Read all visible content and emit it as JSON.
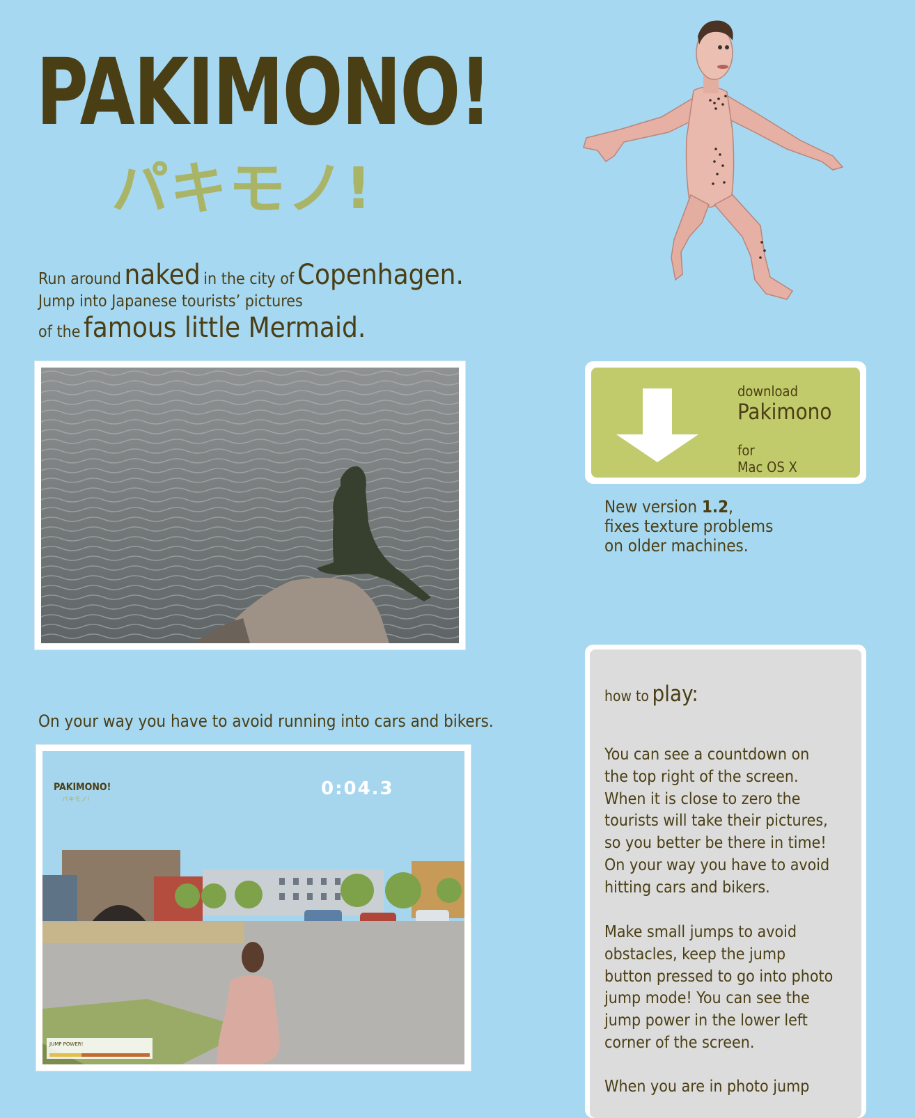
{
  "logo": {
    "title": "PAKIMONO!",
    "katakana": "パキモノ!"
  },
  "tagline": {
    "l1_a": "Run around",
    "l1_b": "naked",
    "l1_c": "in the city of",
    "l1_d": "Copenhagen.",
    "l2": "Jump into Japanese tourists’ pictures",
    "l3_a": "of the",
    "l3_b": "famous little Mermaid."
  },
  "caption2": "On your way you have to avoid running into cars and bikers.",
  "game": {
    "logo": "PAKIMONO!",
    "logo_jp": "パキモノ!",
    "timer": "0:04.3",
    "jump_label": "JUMP POWER!",
    "jump_power": 0.32
  },
  "download": {
    "label": "download",
    "title": "Pakimono",
    "for": "for",
    "platform": "Mac OS X"
  },
  "version": {
    "a": "New version",
    "num": "1.2",
    "comma": ",",
    "line2": "fixes texture problems",
    "line3": "on older machines."
  },
  "howto": {
    "title_a": "how to",
    "title_b": "play:",
    "p1": [
      "You can see a countdown on",
      "the top right of the screen.",
      "When it is close to zero the",
      "tourists will take their pictures,",
      "so you better be there in time!",
      "On your way you have to avoid",
      "hitting cars and bikers."
    ],
    "p2": [
      "Make small jumps to avoid",
      "obstacles, keep the jump",
      "button pressed to go into photo",
      "jump mode! You can see the",
      "jump power in the lower left",
      "corner of the screen."
    ],
    "p3": [
      "When you are in photo jump"
    ]
  }
}
